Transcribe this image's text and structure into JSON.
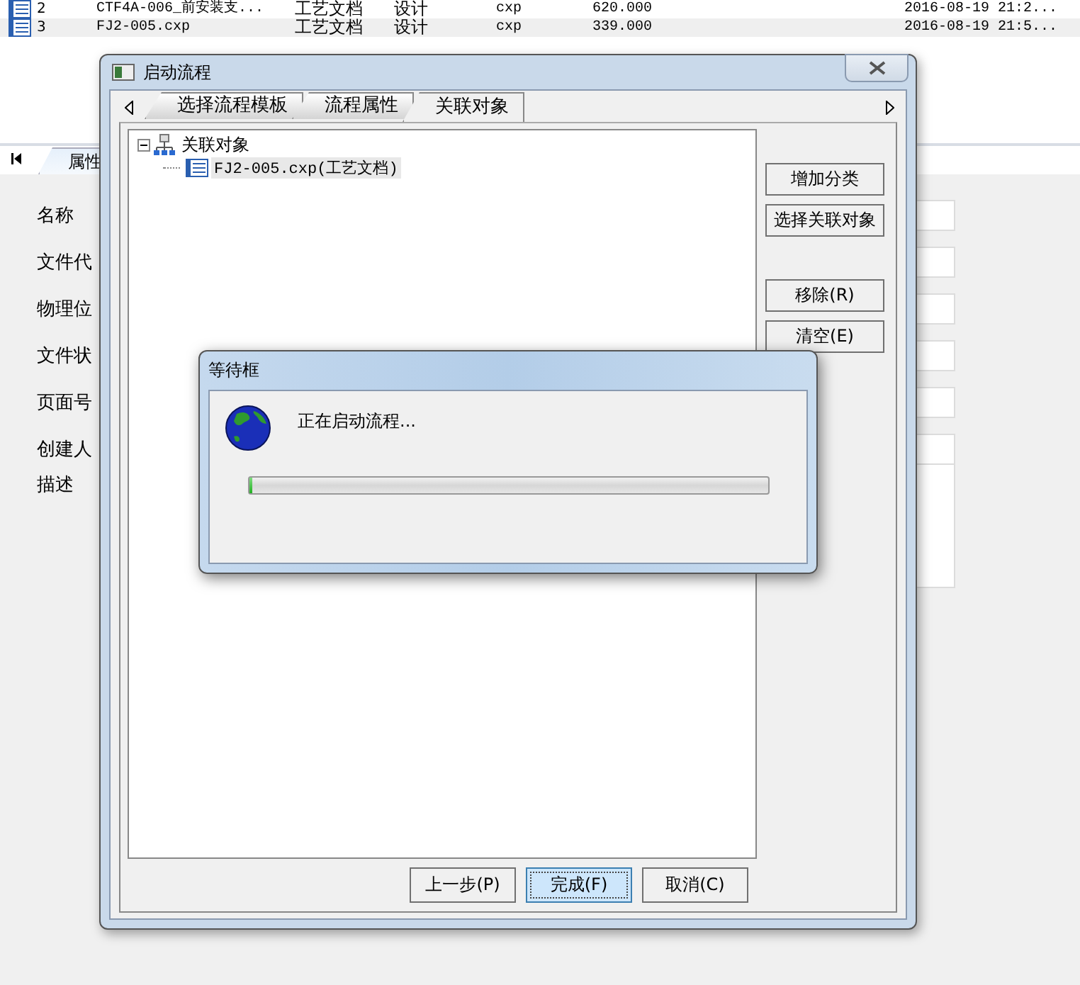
{
  "file_table": {
    "rows": [
      {
        "index": "2",
        "name": "CTF4A-006_前安装支...",
        "type": "工艺文档",
        "stage": "设计",
        "format": "cxp",
        "size": "620.000",
        "modified": "2016-08-19 21:2...",
        "selected": false
      },
      {
        "index": "3",
        "name": "FJ2-005.cxp",
        "type": "工艺文档",
        "stage": "设计",
        "format": "cxp",
        "size": "339.000",
        "modified": "2016-08-19 21:5...",
        "selected": true
      }
    ]
  },
  "properties_panel": {
    "tab": "属性",
    "fields": [
      {
        "label": "名称",
        "kind": "line"
      },
      {
        "label": "文件代",
        "kind": "line"
      },
      {
        "label": "物理位",
        "kind": "line"
      },
      {
        "label": "文件状",
        "kind": "line"
      },
      {
        "label": "页面号",
        "kind": "line"
      },
      {
        "label": "创建人",
        "kind": "line"
      },
      {
        "label": "描述",
        "kind": "area"
      }
    ]
  },
  "start_dialog": {
    "title": "启动流程",
    "tabs": [
      {
        "label": "选择流程模板",
        "selected": false
      },
      {
        "label": "流程属性",
        "selected": false
      },
      {
        "label": "关联对象",
        "selected": true
      }
    ],
    "tree": [
      {
        "label": "关联对象",
        "expanded": true,
        "children": [
          {
            "label": "FJ2-005.cxp(工艺文档)",
            "selected": true
          }
        ]
      }
    ],
    "side_button_groups": [
      [
        "增加分类",
        "选择关联对象"
      ],
      [
        "移除(R)",
        "清空(E)"
      ]
    ],
    "footer_buttons": [
      {
        "label": "上一步(P)",
        "default": false
      },
      {
        "label": "完成(F)",
        "default": true
      },
      {
        "label": "取消(C)",
        "default": false
      }
    ]
  },
  "wait_dialog": {
    "title": "等待框",
    "message": "正在启动流程...",
    "progress": {
      "level": 0
    }
  }
}
